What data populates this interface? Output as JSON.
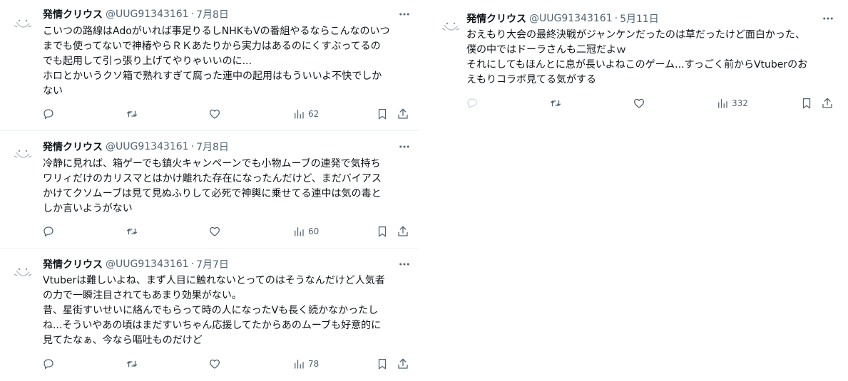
{
  "colors": {
    "text": "#0f1419",
    "muted": "#536471",
    "divider": "#eff3f4",
    "background": "#ffffff"
  },
  "tweets": [
    {
      "name": "発情クリウス",
      "handle": "@UUG91343161",
      "sep": "·",
      "date": "7月8日",
      "text": "こいつの路線はAdoがいれば事足りるしNHKもVの番組やるならこんなのいつ\nまでも使ってないで神椿やらＲＫあたりから実力はあるのにくすぶってるの\nでも起用して引っ張り上げてやりゃいいのに...\nホロとかいうクソ箱で熟れすぎて腐った連中の起用はもういいよ不快でしか\nない",
      "views": "62"
    },
    {
      "name": "発情クリウス",
      "handle": "@UUG91343161",
      "sep": "·",
      "date": "7月8日",
      "text": "冷静に見れば、箱ゲーでも鎮火キャンペーンでも小物ムーブの連発で気持ち\nワリィだけのカリスマとはかけ離れた存在になったんだけど、まだバイアス\nかけてクソムーブは見て見ぬふりして必死で神輿に乗せてる連中は気の毒と\nしか言いようがない",
      "views": "60"
    },
    {
      "name": "発情クリウス",
      "handle": "@UUG91343161",
      "sep": "·",
      "date": "7月7日",
      "text": "Vtuberは難しいよね、まず人目に触れないとってのはそうなんだけど人気者\nの力で一瞬注目されてもあまり効果がない。\n昔、星街すいせいに絡んでもらって時の人になったVも長く続かなかったし\nね...そういやあの頃はまだすいちゃん応援してたからあのムーブも好意的に\n見てたなぁ、今なら嘔吐ものだけど",
      "views": "78"
    },
    {
      "name": "発情クリウス",
      "handle": "@UUG91343161",
      "sep": "·",
      "date": "5月11日",
      "text": "おえもり大会の最終決戦がジャンケンだったのは草だったけど面白かった、\n僕の中ではドーラさんも二冠だよｗ\nそれにしてもほんとに息が長いよねこのゲーム...すっごく前からVtuberのお\nえもりコラボ見てる気がする",
      "views": "332"
    }
  ],
  "icons": [
    "avatar-icon",
    "more-icon",
    "reply-icon",
    "retweet-icon",
    "like-icon",
    "views-icon",
    "bookmark-icon",
    "share-icon"
  ]
}
